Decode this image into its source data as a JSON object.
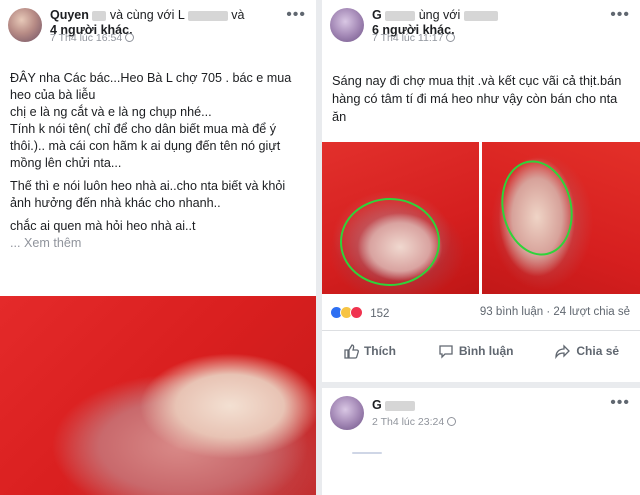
{
  "post_left": {
    "author_prefix": "Quyen",
    "with_text": "và cùng với L",
    "and_text": "và",
    "others": "4 người khác.",
    "time": "7 Th4 lúc 16:54",
    "paragraphs": [
      "ĐÂY nha Các bác...Heo Bà L     chợ 705 . bác e mua heo của bà liễu",
      "chị e là ng cắt và e là ng chụp nhé...",
      "Tính k nói tên( chỉ để cho dân biết mua mà để ý thôi.).. mà cái con hãm     k ai dụng đến tên nó giựt mồng lên chửi nta...",
      "Thế thì e nói luôn heo nhà ai..cho nta biết và khỏi ảnh hưởng đến nhà khác cho nhanh..",
      "chắc ai quen mà hỏi heo nhà ai..t"
    ],
    "see_more": "... Xem thêm"
  },
  "post_right": {
    "author_prefix": "G",
    "with_text": "ùng với",
    "others": "6 người khác.",
    "time": "7 Th4 lúc 11:17",
    "text": "Sáng nay đi chợ mua thịt .và kết cục vãi cả thịt.bán hàng có tâm tí đi má heo như vậy còn bán cho nta ăn",
    "reaction_count": "152",
    "comments": "93 bình luận",
    "shares": "24 lượt chia sẻ",
    "actions": {
      "like": "Thích",
      "comment": "Bình luận",
      "share": "Chia sẻ"
    }
  },
  "post_bottom": {
    "author_prefix": "G",
    "time": "2 Th4 lúc 23:24"
  },
  "more_label": "•••",
  "colors": {
    "accent": "#4267b2",
    "circle": "#2fd33a",
    "meta": "#90949c"
  }
}
